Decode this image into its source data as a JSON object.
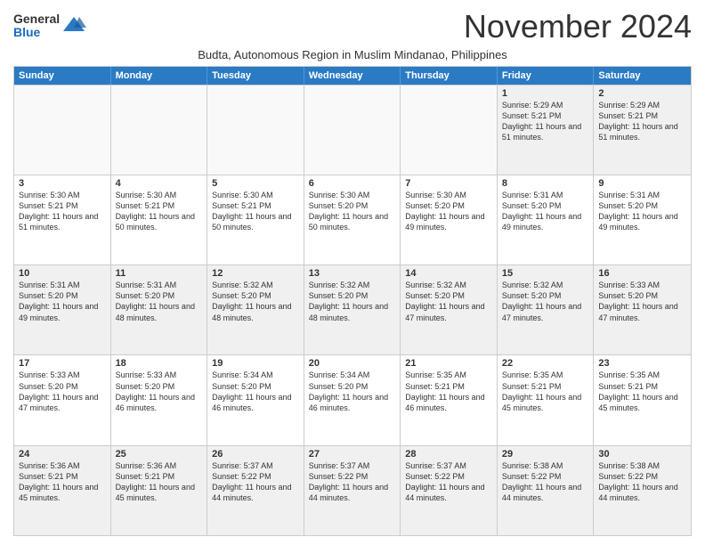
{
  "logo": {
    "general": "General",
    "blue": "Blue"
  },
  "header": {
    "month": "November 2024",
    "subtitle": "Budta, Autonomous Region in Muslim Mindanao, Philippines"
  },
  "weekdays": [
    "Sunday",
    "Monday",
    "Tuesday",
    "Wednesday",
    "Thursday",
    "Friday",
    "Saturday"
  ],
  "rows": [
    [
      {
        "day": "",
        "info": "",
        "empty": true
      },
      {
        "day": "",
        "info": "",
        "empty": true
      },
      {
        "day": "",
        "info": "",
        "empty": true
      },
      {
        "day": "",
        "info": "",
        "empty": true
      },
      {
        "day": "",
        "info": "",
        "empty": true
      },
      {
        "day": "1",
        "info": "Sunrise: 5:29 AM\nSunset: 5:21 PM\nDaylight: 11 hours and 51 minutes."
      },
      {
        "day": "2",
        "info": "Sunrise: 5:29 AM\nSunset: 5:21 PM\nDaylight: 11 hours and 51 minutes."
      }
    ],
    [
      {
        "day": "3",
        "info": "Sunrise: 5:30 AM\nSunset: 5:21 PM\nDaylight: 11 hours and 51 minutes."
      },
      {
        "day": "4",
        "info": "Sunrise: 5:30 AM\nSunset: 5:21 PM\nDaylight: 11 hours and 50 minutes."
      },
      {
        "day": "5",
        "info": "Sunrise: 5:30 AM\nSunset: 5:21 PM\nDaylight: 11 hours and 50 minutes."
      },
      {
        "day": "6",
        "info": "Sunrise: 5:30 AM\nSunset: 5:20 PM\nDaylight: 11 hours and 50 minutes."
      },
      {
        "day": "7",
        "info": "Sunrise: 5:30 AM\nSunset: 5:20 PM\nDaylight: 11 hours and 49 minutes."
      },
      {
        "day": "8",
        "info": "Sunrise: 5:31 AM\nSunset: 5:20 PM\nDaylight: 11 hours and 49 minutes."
      },
      {
        "day": "9",
        "info": "Sunrise: 5:31 AM\nSunset: 5:20 PM\nDaylight: 11 hours and 49 minutes."
      }
    ],
    [
      {
        "day": "10",
        "info": "Sunrise: 5:31 AM\nSunset: 5:20 PM\nDaylight: 11 hours and 49 minutes."
      },
      {
        "day": "11",
        "info": "Sunrise: 5:31 AM\nSunset: 5:20 PM\nDaylight: 11 hours and 48 minutes."
      },
      {
        "day": "12",
        "info": "Sunrise: 5:32 AM\nSunset: 5:20 PM\nDaylight: 11 hours and 48 minutes."
      },
      {
        "day": "13",
        "info": "Sunrise: 5:32 AM\nSunset: 5:20 PM\nDaylight: 11 hours and 48 minutes."
      },
      {
        "day": "14",
        "info": "Sunrise: 5:32 AM\nSunset: 5:20 PM\nDaylight: 11 hours and 47 minutes."
      },
      {
        "day": "15",
        "info": "Sunrise: 5:32 AM\nSunset: 5:20 PM\nDaylight: 11 hours and 47 minutes."
      },
      {
        "day": "16",
        "info": "Sunrise: 5:33 AM\nSunset: 5:20 PM\nDaylight: 11 hours and 47 minutes."
      }
    ],
    [
      {
        "day": "17",
        "info": "Sunrise: 5:33 AM\nSunset: 5:20 PM\nDaylight: 11 hours and 47 minutes."
      },
      {
        "day": "18",
        "info": "Sunrise: 5:33 AM\nSunset: 5:20 PM\nDaylight: 11 hours and 46 minutes."
      },
      {
        "day": "19",
        "info": "Sunrise: 5:34 AM\nSunset: 5:20 PM\nDaylight: 11 hours and 46 minutes."
      },
      {
        "day": "20",
        "info": "Sunrise: 5:34 AM\nSunset: 5:20 PM\nDaylight: 11 hours and 46 minutes."
      },
      {
        "day": "21",
        "info": "Sunrise: 5:35 AM\nSunset: 5:21 PM\nDaylight: 11 hours and 46 minutes."
      },
      {
        "day": "22",
        "info": "Sunrise: 5:35 AM\nSunset: 5:21 PM\nDaylight: 11 hours and 45 minutes."
      },
      {
        "day": "23",
        "info": "Sunrise: 5:35 AM\nSunset: 5:21 PM\nDaylight: 11 hours and 45 minutes."
      }
    ],
    [
      {
        "day": "24",
        "info": "Sunrise: 5:36 AM\nSunset: 5:21 PM\nDaylight: 11 hours and 45 minutes."
      },
      {
        "day": "25",
        "info": "Sunrise: 5:36 AM\nSunset: 5:21 PM\nDaylight: 11 hours and 45 minutes."
      },
      {
        "day": "26",
        "info": "Sunrise: 5:37 AM\nSunset: 5:22 PM\nDaylight: 11 hours and 44 minutes."
      },
      {
        "day": "27",
        "info": "Sunrise: 5:37 AM\nSunset: 5:22 PM\nDaylight: 11 hours and 44 minutes."
      },
      {
        "day": "28",
        "info": "Sunrise: 5:37 AM\nSunset: 5:22 PM\nDaylight: 11 hours and 44 minutes."
      },
      {
        "day": "29",
        "info": "Sunrise: 5:38 AM\nSunset: 5:22 PM\nDaylight: 11 hours and 44 minutes."
      },
      {
        "day": "30",
        "info": "Sunrise: 5:38 AM\nSunset: 5:22 PM\nDaylight: 11 hours and 44 minutes."
      }
    ]
  ]
}
